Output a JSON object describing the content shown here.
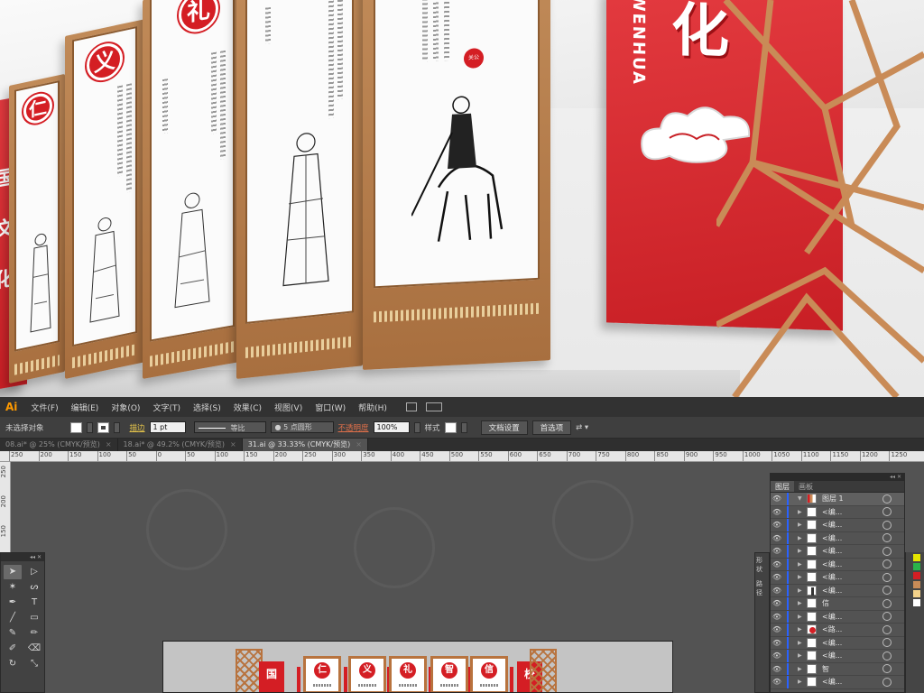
{
  "scene": {
    "boards": [
      {
        "seal_char": "仁"
      },
      {
        "seal_char": "义"
      },
      {
        "seal_char": "礼"
      }
    ],
    "small_seal": "关公",
    "red_board": {
      "latin_text": "WENHUA",
      "main_char": "化"
    },
    "left_board_text": "国 文化"
  },
  "menubar": {
    "logo": "Ai",
    "items": [
      "文件(F)",
      "编辑(E)",
      "对象(O)",
      "文字(T)",
      "选择(S)",
      "效果(C)",
      "视图(V)",
      "窗口(W)",
      "帮助(H)"
    ]
  },
  "control_bar": {
    "selection_status": "未选择对象",
    "stroke_label": "描边",
    "stroke_weight": "1 pt",
    "stroke_profile": "等比",
    "brush": "5 点圆形",
    "opacity_label": "不透明度",
    "opacity_value": "100%",
    "style_label": "样式",
    "doc_setup": "文档设置",
    "preferences": "首选项"
  },
  "doc_tabs": [
    {
      "label": "08.ai* @ 25% (CMYK/预览)",
      "active": false
    },
    {
      "label": "18.ai* @ 49.2% (CMYK/预览)",
      "active": false
    },
    {
      "label": "31.ai @ 33.33% (CMYK/预览)",
      "active": true
    }
  ],
  "ruler_h": [
    "250",
    "200",
    "150",
    "100",
    "50",
    "0",
    "50",
    "100",
    "150",
    "200",
    "250",
    "300",
    "350",
    "400",
    "450",
    "500",
    "550",
    "600",
    "650",
    "700",
    "750",
    "800",
    "850",
    "900",
    "950",
    "1000",
    "1050",
    "1100",
    "1150",
    "1200",
    "1250"
  ],
  "ruler_v": [
    "250",
    "200",
    "150"
  ],
  "artboard": {
    "left_sign": "国",
    "right_sign": "校",
    "panels": [
      "仁",
      "义",
      "礼",
      "智",
      "信"
    ]
  },
  "layers_panel": {
    "tabs": [
      "图层",
      "画板"
    ],
    "rows": [
      {
        "name": "图层 1",
        "thumb": "mixed",
        "top": true
      },
      {
        "name": "<编...",
        "thumb": "white"
      },
      {
        "name": "<编...",
        "thumb": "white"
      },
      {
        "name": "<编...",
        "thumb": "white"
      },
      {
        "name": "<编...",
        "thumb": "white"
      },
      {
        "name": "<编...",
        "thumb": "white"
      },
      {
        "name": "<编...",
        "thumb": "white"
      },
      {
        "name": "<编...",
        "thumb": "figure"
      },
      {
        "name": "信",
        "thumb": "white"
      },
      {
        "name": "<编...",
        "thumb": "white"
      },
      {
        "name": "<路...",
        "thumb": "red"
      },
      {
        "name": "<编...",
        "thumb": "white"
      },
      {
        "name": "<编...",
        "thumb": "white"
      },
      {
        "name": "智",
        "thumb": "white"
      },
      {
        "name": "<编...",
        "thumb": "white"
      }
    ]
  },
  "side_stub": [
    "形状",
    "路径"
  ],
  "colors": {
    "brand_red": "#d41e24",
    "wood": "#b8733e",
    "ui_dark": "#323232",
    "ai_orange": "#ff9a00",
    "layer_blue": "#2a62ff"
  }
}
